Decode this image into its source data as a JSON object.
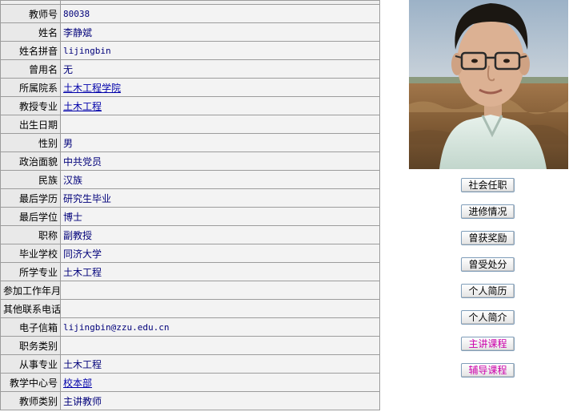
{
  "profile": {
    "rows": [
      {
        "label": "教师号",
        "value": "80038",
        "mono": true
      },
      {
        "label": "姓名",
        "value": "李静斌"
      },
      {
        "label": "姓名拼音",
        "value": "lijingbin",
        "mono": true
      },
      {
        "label": "曾用名",
        "value": "无"
      },
      {
        "label": "所属院系",
        "value": "土木工程学院",
        "link": true
      },
      {
        "label": "教授专业",
        "value": "土木工程",
        "link": true
      },
      {
        "label": "出生日期",
        "value": ""
      },
      {
        "label": "性别",
        "value": "男"
      },
      {
        "label": "政治面貌",
        "value": "中共党员"
      },
      {
        "label": "民族",
        "value": "汉族"
      },
      {
        "label": "最后学历",
        "value": "研究生毕业"
      },
      {
        "label": "最后学位",
        "value": "博士"
      },
      {
        "label": "职称",
        "value": "副教授"
      },
      {
        "label": "毕业学校",
        "value": "同济大学"
      },
      {
        "label": "所学专业",
        "value": "土木工程"
      },
      {
        "label": "参加工作年月",
        "value": ""
      },
      {
        "label": "其他联系电话",
        "value": ""
      },
      {
        "label": "电子信箱",
        "value": "lijingbin@zzu.edu.cn",
        "mono": true
      },
      {
        "label": "职务类别",
        "value": ""
      },
      {
        "label": "从事专业",
        "value": "土木工程"
      },
      {
        "label": "教学中心号",
        "value": "校本部",
        "link": true
      },
      {
        "label": "教师类别",
        "value": "主讲教师"
      }
    ]
  },
  "side_buttons": [
    {
      "label": "社会任职",
      "highlight": false
    },
    {
      "label": "进修情况",
      "highlight": false
    },
    {
      "label": "曾获奖励",
      "highlight": false
    },
    {
      "label": "曾受处分",
      "highlight": false
    },
    {
      "label": "个人简历",
      "highlight": false
    },
    {
      "label": "个人简介",
      "highlight": false
    },
    {
      "label": "主讲课程",
      "highlight": true
    },
    {
      "label": "辅导课程",
      "highlight": true
    }
  ]
}
